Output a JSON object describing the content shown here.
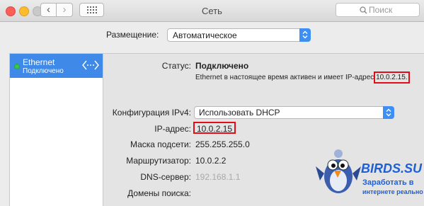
{
  "window": {
    "title": "Сеть"
  },
  "toolbar": {
    "back_glyph": "‹",
    "forward_glyph": "›",
    "search_placeholder": "Поиск"
  },
  "location": {
    "label": "Размещение:",
    "value": "Автоматическое"
  },
  "sidebar": {
    "items": [
      {
        "name": "Ethernet",
        "status": "Подключено",
        "status_color": "#35c84b",
        "icon": "ethernet-icon"
      }
    ]
  },
  "detail": {
    "status_label": "Статус:",
    "status_value": "Подключено",
    "status_desc_prefix": "Ethernet в настоящее время активен и имеет IP-адрес",
    "status_desc_ip": "10.0.2.15.",
    "config_label": "Конфигурация IPv4:",
    "config_value": "Использовать DHCP",
    "ip_label": "IP-адрес:",
    "ip_value": "10.0.2.15",
    "mask_label": "Маска подсети:",
    "mask_value": "255.255.255.0",
    "router_label": "Маршрутизатор:",
    "router_value": "10.0.2.2",
    "dns_label": "DNS-сервер:",
    "dns_value": "192.168.1.1",
    "domains_label": "Домены поиска:"
  },
  "watermark": {
    "logo": "bird-logo",
    "title": "BIRDS.SU",
    "line1": "Заработать в",
    "line2": "интернете реально"
  },
  "colors": {
    "accent": "#3f89e8",
    "highlight": "#e10d18",
    "watermark": "#1f5fd6"
  }
}
